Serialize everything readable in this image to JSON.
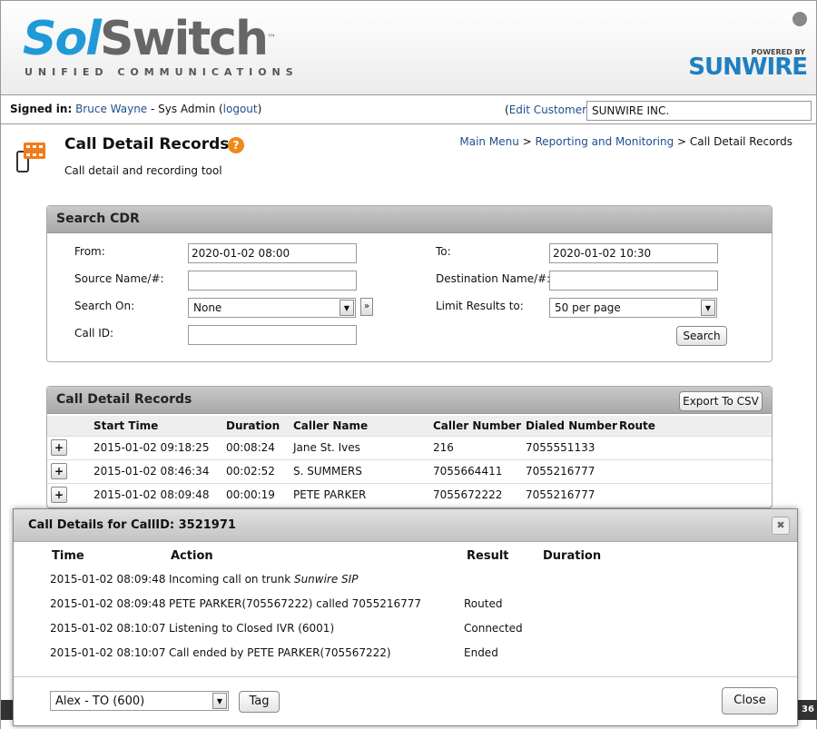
{
  "header": {
    "logo_sol": "Sol",
    "logo_switch": "Switch",
    "logo_tm": "™",
    "logo_sub": "UNIFIED COMMUNICATIONS",
    "powered_by": "POWERED BY",
    "brand": "SUNWIRE"
  },
  "signbar": {
    "signed_in_label": "Signed in:",
    "user": "Bruce Wayne",
    "role": " - Sys Admin (",
    "logout": "logout",
    "logout_close": ")",
    "edit_open": "(",
    "edit_customer": "Edit Customer",
    "edit_close": ")",
    "customer": "SUNWIRE INC."
  },
  "page": {
    "title": "Call Detail Records",
    "help": "?",
    "subtitle": "Call detail and recording tool",
    "breadcrumb": {
      "main_menu": "Main Menu",
      "sep1": " > ",
      "reporting": "Reporting and Monitoring",
      "sep2": " > ",
      "current": "Call Detail Records"
    }
  },
  "search": {
    "title": "Search CDR",
    "from_label": "From:",
    "from_value": "2020-01-02 08:00",
    "to_label": "To:",
    "to_value": "2020-01-02 10:30",
    "source_label": "Source Name/#:",
    "source_value": "",
    "dest_label": "Destination Name/#:",
    "dest_value": "",
    "search_on_label": "Search On:",
    "search_on_value": "None",
    "limit_label": "Limit Results to:",
    "limit_value": "50 per page",
    "callid_label": "Call ID:",
    "callid_value": "",
    "more_btn": "»",
    "search_btn": "Search"
  },
  "cdr": {
    "title": "Call Detail Records",
    "export_btn": "Export To CSV",
    "columns": [
      "Start Time",
      "Duration",
      "Caller Name",
      "Caller Number",
      "Dialed Number",
      "Route"
    ],
    "rows": [
      {
        "start": "2015-01-02 09:18:25",
        "duration": "00:08:24",
        "caller_name": "Jane St. Ives",
        "caller_number": "216",
        "dialed": "7055551133",
        "route": ""
      },
      {
        "start": "2015-01-02 08:46:34",
        "duration": "00:02:52",
        "caller_name": "S. SUMMERS",
        "caller_number": "7055664411",
        "dialed": "7055216777",
        "route": ""
      },
      {
        "start": "2015-01-02 08:09:48",
        "duration": "00:00:19",
        "caller_name": "PETE PARKER",
        "caller_number": "7055672222",
        "dialed": "7055216777",
        "route": ""
      }
    ]
  },
  "footer_right": "36",
  "modal": {
    "title": "Call Details for CallID: 3521971",
    "close_icon": "✖",
    "columns": [
      "Time",
      "Action",
      "Result",
      "Duration"
    ],
    "rows": [
      {
        "time": "2015-01-02 08:09:48",
        "action": "Incoming call on trunk ",
        "action_em": "Sunwire SIP",
        "result": "",
        "duration": ""
      },
      {
        "time": "2015-01-02 08:09:48",
        "action": "PETE PARKER(705567222) called 7055216777",
        "action_em": "",
        "result": "Routed",
        "duration": ""
      },
      {
        "time": "2015-01-02 08:10:07",
        "action": "Listening to Closed IVR (6001)",
        "action_em": "",
        "result": "Connected",
        "duration": ""
      },
      {
        "time": "2015-01-02 08:10:07",
        "action": "Call ended by PETE PARKER(705567222)",
        "action_em": "",
        "result": "Ended",
        "duration": ""
      }
    ],
    "tag_select": "Alex - TO (600)",
    "tag_btn": "Tag",
    "close_btn": "Close"
  }
}
